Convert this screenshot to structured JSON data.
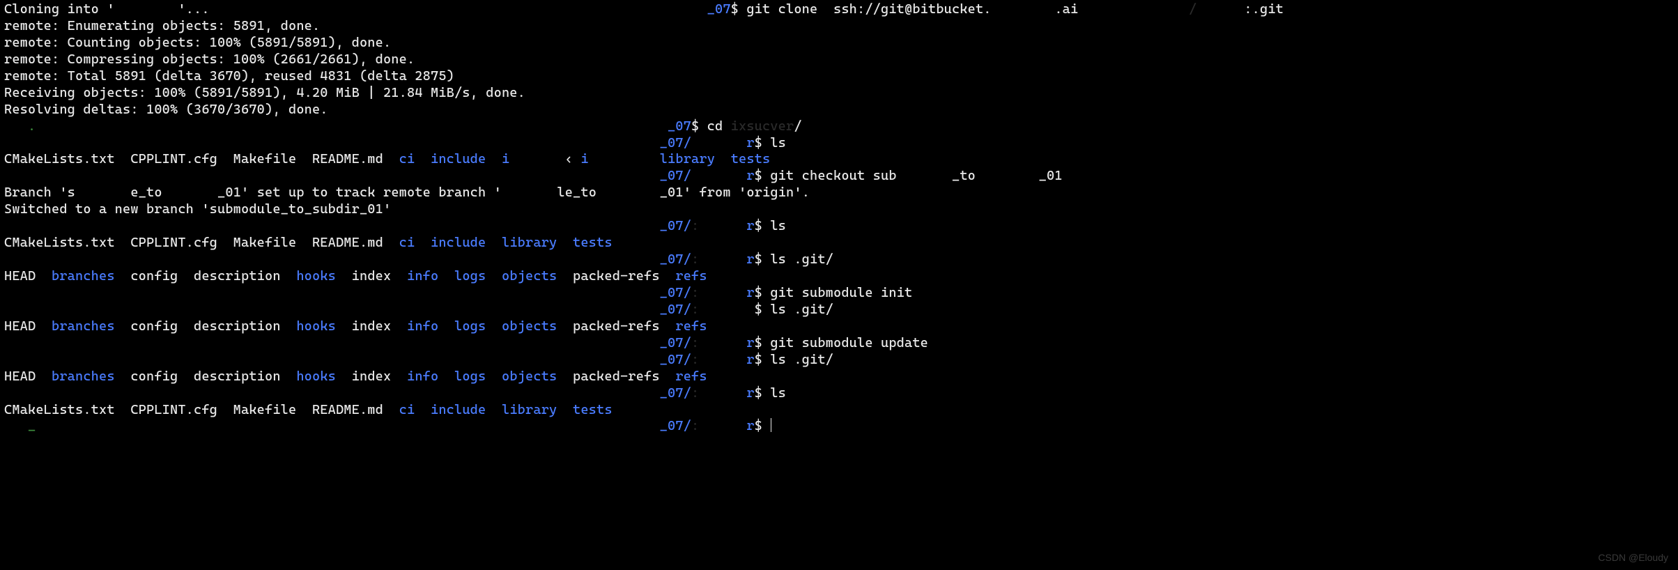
{
  "watermark": "CSDN @Eloudy",
  "lines": [
    {
      "segs": [
        {
          "t": "Cloning into '",
          "c": ""
        },
        {
          "t": "        ",
          "c": "dim"
        },
        {
          "t": "'...",
          "c": ""
        },
        {
          "t": "                                                               ",
          "c": ""
        },
        {
          "t": "_07",
          "c": "path"
        },
        {
          "t": "$ ",
          "c": "ps1"
        },
        {
          "t": "git clone  ssh://git@bitbucket.",
          "c": "cmd"
        },
        {
          "t": "        ",
          "c": "dim"
        },
        {
          "t": ".ai",
          "c": "cmd"
        },
        {
          "t": "              /      ",
          "c": "dim"
        },
        {
          "t": ":.git",
          "c": "cmd"
        }
      ]
    },
    {
      "segs": [
        {
          "t": "remote: Enumerating objects: 5891, done.",
          "c": ""
        }
      ]
    },
    {
      "segs": [
        {
          "t": "remote: Counting objects: 100% (5891/5891), done.",
          "c": ""
        }
      ]
    },
    {
      "segs": [
        {
          "t": "remote: Compressing objects: 100% (2661/2661), done.",
          "c": ""
        }
      ]
    },
    {
      "segs": [
        {
          "t": "remote: Total 5891 (delta 3670), reused 4831 (delta 2875)",
          "c": ""
        }
      ]
    },
    {
      "segs": [
        {
          "t": "Receiving objects: 100% (5891/5891), 4.20 MiB | 21.84 MiB/s, done.",
          "c": ""
        }
      ]
    },
    {
      "segs": [
        {
          "t": "Resolving deltas: 100% (3670/3670), done.",
          "c": ""
        }
      ]
    },
    {
      "segs": [
        {
          "t": "   ",
          "c": ""
        },
        {
          "t": ".",
          "c": "comment"
        },
        {
          "t": "                                                                                ",
          "c": ""
        },
        {
          "t": "_07",
          "c": "path"
        },
        {
          "t": "$ ",
          "c": "ps1"
        },
        {
          "t": "cd ",
          "c": "cmd"
        },
        {
          "t": "ixsucver",
          "c": "dim"
        },
        {
          "t": "/",
          "c": "cmd"
        }
      ]
    },
    {
      "segs": [
        {
          "t": "                                                                                   ",
          "c": ""
        },
        {
          "t": "_07/",
          "c": "path"
        },
        {
          "t": "       ",
          "c": "dim"
        },
        {
          "t": "r",
          "c": "path"
        },
        {
          "t": "$ ",
          "c": "ps1"
        },
        {
          "t": "ls",
          "c": "cmd"
        }
      ]
    },
    {
      "segs": [
        {
          "t": "CMakeLists.txt  CPPLINT.cfg  Makefile  README.md  ",
          "c": ""
        },
        {
          "t": "ci",
          "c": "blue"
        },
        {
          "t": "  ",
          "c": ""
        },
        {
          "t": "include",
          "c": "blue"
        },
        {
          "t": "  ",
          "c": ""
        },
        {
          "t": "i",
          "c": "blue"
        },
        {
          "t": "       ",
          "c": "dim"
        },
        {
          "t": "‹ ",
          "c": ""
        },
        {
          "t": "i",
          "c": "blue"
        },
        {
          "t": "         ",
          "c": ""
        },
        {
          "t": "library",
          "c": "blue"
        },
        {
          "t": "  ",
          "c": ""
        },
        {
          "t": "tests",
          "c": "blue"
        }
      ]
    },
    {
      "segs": [
        {
          "t": "                                                                                   ",
          "c": ""
        },
        {
          "t": "_07/",
          "c": "path"
        },
        {
          "t": "       ",
          "c": "dim"
        },
        {
          "t": "r",
          "c": "path"
        },
        {
          "t": "$ ",
          "c": "ps1"
        },
        {
          "t": "git checkout sub",
          "c": "cmd"
        },
        {
          "t": "       ",
          "c": "dim"
        },
        {
          "t": "_to",
          "c": "cmd"
        },
        {
          "t": "        ",
          "c": "dim"
        },
        {
          "t": "_01",
          "c": "cmd"
        }
      ]
    },
    {
      "segs": [
        {
          "t": "Branch 's",
          "c": ""
        },
        {
          "t": "       ",
          "c": "dim"
        },
        {
          "t": "e_to",
          "c": ""
        },
        {
          "t": "       ",
          "c": "dim"
        },
        {
          "t": "_01' set up to track remote branch '",
          "c": ""
        },
        {
          "t": "       ",
          "c": "dim"
        },
        {
          "t": "le_to",
          "c": ""
        },
        {
          "t": "        ",
          "c": "dim"
        },
        {
          "t": "_01' from 'origin'.",
          "c": ""
        }
      ]
    },
    {
      "segs": [
        {
          "t": "Switched to a new branch 'submodule_to_subdir_01'",
          "c": ""
        }
      ]
    },
    {
      "segs": [
        {
          "t": "                                                                                   ",
          "c": ""
        },
        {
          "t": "_07/",
          "c": "path"
        },
        {
          "t": ":      ",
          "c": "dim"
        },
        {
          "t": "r",
          "c": "path"
        },
        {
          "t": "$ ",
          "c": "ps1"
        },
        {
          "t": "ls",
          "c": "cmd"
        }
      ]
    },
    {
      "segs": [
        {
          "t": "CMakeLists.txt  CPPLINT.cfg  Makefile  README.md  ",
          "c": ""
        },
        {
          "t": "ci",
          "c": "blue"
        },
        {
          "t": "  ",
          "c": ""
        },
        {
          "t": "include",
          "c": "blue"
        },
        {
          "t": "  ",
          "c": ""
        },
        {
          "t": "library",
          "c": "blue"
        },
        {
          "t": "  ",
          "c": ""
        },
        {
          "t": "tests",
          "c": "blue"
        }
      ]
    },
    {
      "segs": [
        {
          "t": "                                                                                   ",
          "c": ""
        },
        {
          "t": "_07/",
          "c": "path"
        },
        {
          "t": ":      ",
          "c": "dim"
        },
        {
          "t": "r",
          "c": "path"
        },
        {
          "t": "$ ",
          "c": "ps1"
        },
        {
          "t": "ls .git/",
          "c": "cmd"
        }
      ]
    },
    {
      "segs": [
        {
          "t": "HEAD  ",
          "c": ""
        },
        {
          "t": "branches",
          "c": "blue"
        },
        {
          "t": "  config  description  ",
          "c": ""
        },
        {
          "t": "hooks",
          "c": "blue"
        },
        {
          "t": "  index  ",
          "c": ""
        },
        {
          "t": "info",
          "c": "blue"
        },
        {
          "t": "  ",
          "c": ""
        },
        {
          "t": "logs",
          "c": "blue"
        },
        {
          "t": "  ",
          "c": ""
        },
        {
          "t": "objects",
          "c": "blue"
        },
        {
          "t": "  packed-refs  ",
          "c": ""
        },
        {
          "t": "refs",
          "c": "blue"
        }
      ]
    },
    {
      "segs": [
        {
          "t": "                                                                                   ",
          "c": ""
        },
        {
          "t": "_07/",
          "c": "path"
        },
        {
          "t": ":      ",
          "c": "dim"
        },
        {
          "t": "r",
          "c": "path"
        },
        {
          "t": "$ ",
          "c": "ps1"
        },
        {
          "t": "git submodule init",
          "c": "cmd"
        }
      ]
    },
    {
      "segs": [
        {
          "t": "                                                                                   ",
          "c": ""
        },
        {
          "t": "_07/",
          "c": "path"
        },
        {
          "t": ":       ",
          "c": "dim"
        },
        {
          "t": "$ ",
          "c": "ps1"
        },
        {
          "t": "ls .git/",
          "c": "cmd"
        }
      ]
    },
    {
      "segs": [
        {
          "t": "HEAD  ",
          "c": ""
        },
        {
          "t": "branches",
          "c": "blue"
        },
        {
          "t": "  config  description  ",
          "c": ""
        },
        {
          "t": "hooks",
          "c": "blue"
        },
        {
          "t": "  index  ",
          "c": ""
        },
        {
          "t": "info",
          "c": "blue"
        },
        {
          "t": "  ",
          "c": ""
        },
        {
          "t": "logs",
          "c": "blue"
        },
        {
          "t": "  ",
          "c": ""
        },
        {
          "t": "objects",
          "c": "blue"
        },
        {
          "t": "  packed-refs  ",
          "c": ""
        },
        {
          "t": "refs",
          "c": "blue"
        }
      ]
    },
    {
      "segs": [
        {
          "t": "                                                                                   ",
          "c": ""
        },
        {
          "t": "_07/",
          "c": "path"
        },
        {
          "t": ":      ",
          "c": "dim"
        },
        {
          "t": "r",
          "c": "path"
        },
        {
          "t": "$ ",
          "c": "ps1"
        },
        {
          "t": "git submodule update",
          "c": "cmd"
        }
      ]
    },
    {
      "segs": [
        {
          "t": "                                                                                   ",
          "c": ""
        },
        {
          "t": "_07/",
          "c": "path"
        },
        {
          "t": ":      ",
          "c": "dim"
        },
        {
          "t": "r",
          "c": "path"
        },
        {
          "t": "$ ",
          "c": "ps1"
        },
        {
          "t": "ls .git/",
          "c": "cmd"
        }
      ]
    },
    {
      "segs": [
        {
          "t": "HEAD  ",
          "c": ""
        },
        {
          "t": "branches",
          "c": "blue"
        },
        {
          "t": "  config  description  ",
          "c": ""
        },
        {
          "t": "hooks",
          "c": "blue"
        },
        {
          "t": "  index  ",
          "c": ""
        },
        {
          "t": "info",
          "c": "blue"
        },
        {
          "t": "  ",
          "c": ""
        },
        {
          "t": "logs",
          "c": "blue"
        },
        {
          "t": "  ",
          "c": ""
        },
        {
          "t": "objects",
          "c": "blue"
        },
        {
          "t": "  packed-refs  ",
          "c": ""
        },
        {
          "t": "refs",
          "c": "blue"
        }
      ]
    },
    {
      "segs": [
        {
          "t": "                                                                                   ",
          "c": ""
        },
        {
          "t": "_07/",
          "c": "path"
        },
        {
          "t": ":      ",
          "c": "dim"
        },
        {
          "t": "r",
          "c": "path"
        },
        {
          "t": "$ ",
          "c": "ps1"
        },
        {
          "t": "ls",
          "c": "cmd"
        }
      ]
    },
    {
      "segs": [
        {
          "t": "CMakeLists.txt  CPPLINT.cfg  Makefile  README.md  ",
          "c": ""
        },
        {
          "t": "ci",
          "c": "blue"
        },
        {
          "t": "  ",
          "c": ""
        },
        {
          "t": "include",
          "c": "blue"
        },
        {
          "t": "  ",
          "c": ""
        },
        {
          "t": "library",
          "c": "blue"
        },
        {
          "t": "  ",
          "c": ""
        },
        {
          "t": "tests",
          "c": "blue"
        }
      ]
    },
    {
      "segs": [
        {
          "t": "   ",
          "c": ""
        },
        {
          "t": "_",
          "c": "comment"
        },
        {
          "t": "                                                                               ",
          "c": ""
        },
        {
          "t": "_07/",
          "c": "path"
        },
        {
          "t": ":      ",
          "c": "dim"
        },
        {
          "t": "r",
          "c": "path"
        },
        {
          "t": "$ ",
          "c": "ps1"
        },
        {
          "t": "",
          "c": "cmd",
          "cursor": true
        }
      ]
    }
  ]
}
